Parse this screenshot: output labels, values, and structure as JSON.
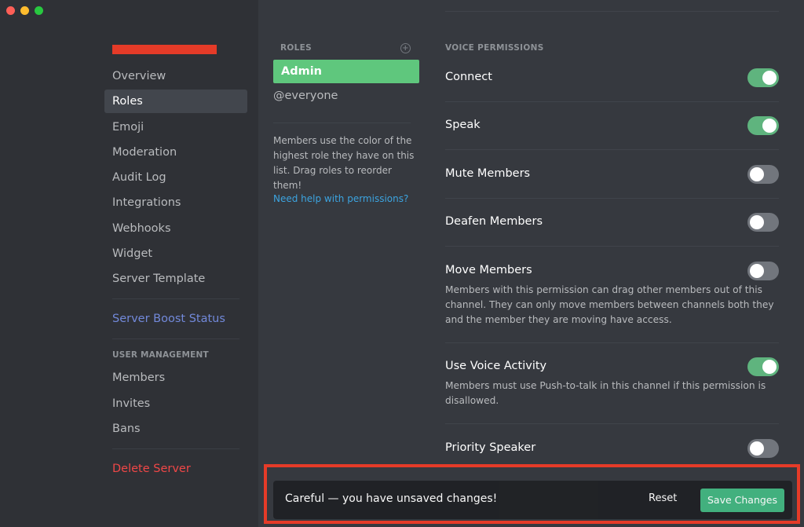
{
  "sidebar": {
    "items": [
      {
        "label": "Overview"
      },
      {
        "label": "Roles"
      },
      {
        "label": "Emoji"
      },
      {
        "label": "Moderation"
      },
      {
        "label": "Audit Log"
      },
      {
        "label": "Integrations"
      },
      {
        "label": "Webhooks"
      },
      {
        "label": "Widget"
      },
      {
        "label": "Server Template"
      }
    ],
    "active_item": "Roles",
    "boost_label": "Server Boost Status",
    "user_management_header": "USER MANAGEMENT",
    "user_items": [
      {
        "label": "Members"
      },
      {
        "label": "Invites"
      },
      {
        "label": "Bans"
      }
    ],
    "delete_label": "Delete Server"
  },
  "roles": {
    "header": "ROLES",
    "add_icon": "plus-circle-icon",
    "items": [
      {
        "label": "Admin",
        "selected": true,
        "color": "#5fc77d"
      },
      {
        "label": "@everyone",
        "selected": false
      }
    ],
    "note": "Members use the color of the highest role they have on this list. Drag roles to reorder them!",
    "help_link": "Need help with permissions?"
  },
  "permissions": {
    "header": "VOICE PERMISSIONS",
    "items": [
      {
        "title": "Connect",
        "enabled": true,
        "description": ""
      },
      {
        "title": "Speak",
        "enabled": true,
        "description": ""
      },
      {
        "title": "Mute Members",
        "enabled": false,
        "description": ""
      },
      {
        "title": "Deafen Members",
        "enabled": false,
        "description": ""
      },
      {
        "title": "Move Members",
        "enabled": false,
        "description": "Members with this permission can drag other members out of this channel. They can only move members between channels both they and the member they are moving have access."
      },
      {
        "title": "Use Voice Activity",
        "enabled": true,
        "description": "Members must use Push-to-talk in this channel if this permission is disallowed."
      },
      {
        "title": "Priority Speaker",
        "enabled": false,
        "description": ""
      }
    ]
  },
  "unsaved": {
    "message": "Careful — you have unsaved changes!",
    "reset_label": "Reset",
    "save_label": "Save Changes"
  },
  "colors": {
    "accent_green": "#43b581",
    "annotation_red": "#e53b28",
    "link_blue": "#3ca4e0",
    "boost_purple": "#7289da",
    "danger_red": "#f04747"
  }
}
